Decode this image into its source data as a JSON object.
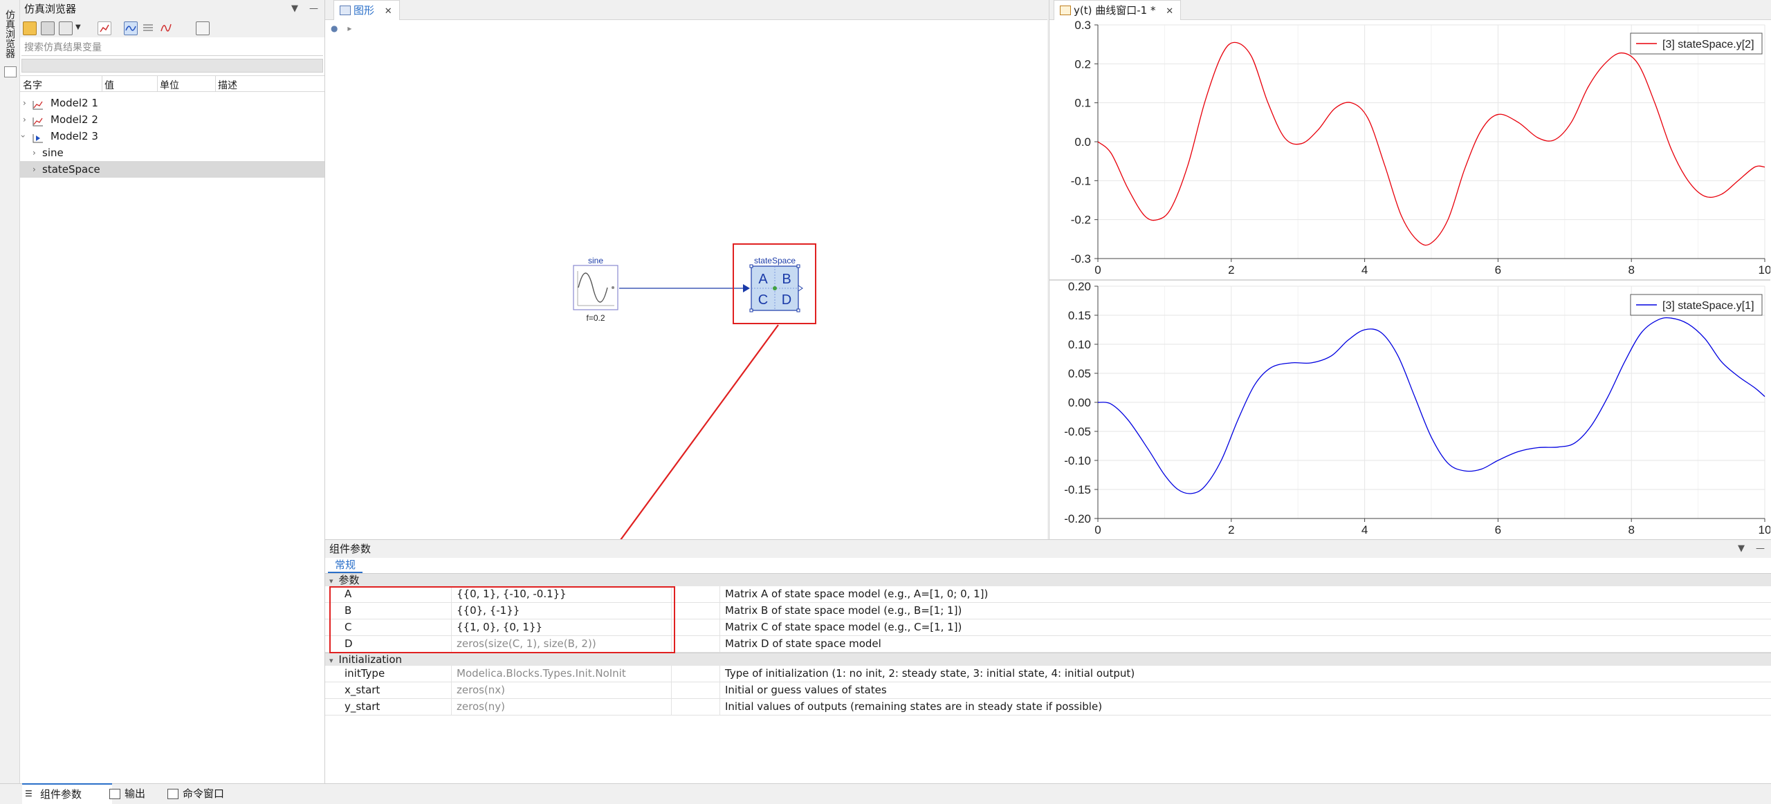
{
  "sim_browser": {
    "vertical_tab_label": "仿真浏览器",
    "title": "仿真浏览器",
    "search_placeholder": "搜索仿真结果变量",
    "columns": [
      "名字",
      "值",
      "单位",
      "描述"
    ],
    "tree": [
      {
        "label": "Model2 1",
        "icon": "plot-result-icon",
        "expanded": false,
        "level": 0
      },
      {
        "label": "Model2 2",
        "icon": "plot-result-icon",
        "expanded": false,
        "level": 0
      },
      {
        "label": "Model2 3",
        "icon": "run-result-icon",
        "expanded": true,
        "level": 0
      },
      {
        "label": "sine",
        "expanded": false,
        "level": 1
      },
      {
        "label": "stateSpace",
        "expanded": false,
        "level": 1,
        "selected": true
      }
    ]
  },
  "diagram": {
    "tab_label": "图形",
    "sine_label": "sine",
    "sine_param": "f=0.2",
    "ss_label": "stateSpace",
    "ss_letters": [
      "A",
      "B",
      "C",
      "D"
    ]
  },
  "plot_window": {
    "tab_label": "y(t) 曲线窗口-1 *"
  },
  "chart_data": [
    {
      "type": "line",
      "title": "",
      "xlabel": "",
      "ylabel": "",
      "xlim": [
        0,
        10
      ],
      "ylim": [
        -0.3,
        0.3
      ],
      "x_ticks": [
        "0",
        "2",
        "4",
        "6",
        "8",
        "10"
      ],
      "y_ticks": [
        "0.3",
        "0.2",
        "0.1",
        "0.0",
        "-0.1",
        "-0.2",
        "-0.3"
      ],
      "grid": true,
      "legend_position": "top-right",
      "series": [
        {
          "name": "[3] stateSpace.y[2]",
          "color": "#e8000b",
          "x": [
            0,
            0.2,
            0.45,
            0.7,
            0.9,
            1.1,
            1.35,
            1.6,
            1.85,
            2.05,
            2.3,
            2.55,
            2.8,
            3.05,
            3.3,
            3.55,
            3.8,
            4.05,
            4.3,
            4.55,
            4.8,
            5.0,
            5.25,
            5.5,
            5.75,
            6.0,
            6.3,
            6.6,
            6.85,
            7.1,
            7.35,
            7.6,
            7.85,
            8.1,
            8.35,
            8.6,
            8.85,
            9.1,
            9.35,
            9.6,
            9.85,
            10.0
          ],
          "y": [
            0,
            -0.03,
            -0.12,
            -0.19,
            -0.2,
            -0.17,
            -0.06,
            0.1,
            0.22,
            0.255,
            0.22,
            0.1,
            0.01,
            -0.005,
            0.03,
            0.085,
            0.1,
            0.06,
            -0.06,
            -0.19,
            -0.255,
            -0.26,
            -0.2,
            -0.07,
            0.03,
            0.07,
            0.05,
            0.01,
            0.005,
            0.05,
            0.14,
            0.2,
            0.228,
            0.2,
            0.1,
            -0.02,
            -0.1,
            -0.14,
            -0.135,
            -0.1,
            -0.065,
            -0.065
          ]
        }
      ]
    },
    {
      "type": "line",
      "title": "",
      "xlabel": "",
      "ylabel": "",
      "xlim": [
        0,
        10
      ],
      "ylim": [
        -0.2,
        0.2
      ],
      "x_ticks": [
        "0",
        "2",
        "4",
        "6",
        "8",
        "10"
      ],
      "y_ticks": [
        "0.20",
        "0.15",
        "0.10",
        "0.05",
        "0.00",
        "-0.05",
        "-0.10",
        "-0.15",
        "-0.20"
      ],
      "grid": true,
      "legend_position": "top-right",
      "series": [
        {
          "name": "[3] stateSpace.y[1]",
          "color": "#0000e0",
          "x": [
            0,
            0.2,
            0.45,
            0.75,
            1.0,
            1.2,
            1.4,
            1.6,
            1.85,
            2.1,
            2.35,
            2.6,
            2.9,
            3.2,
            3.5,
            3.75,
            4.0,
            4.25,
            4.5,
            4.75,
            5.0,
            5.25,
            5.5,
            5.75,
            6.0,
            6.3,
            6.6,
            6.9,
            7.15,
            7.4,
            7.65,
            7.9,
            8.15,
            8.4,
            8.6,
            8.85,
            9.1,
            9.35,
            9.6,
            9.85,
            10.0
          ],
          "y": [
            0,
            -0.003,
            -0.03,
            -0.08,
            -0.125,
            -0.15,
            -0.157,
            -0.145,
            -0.1,
            -0.03,
            0.03,
            0.06,
            0.068,
            0.068,
            0.08,
            0.107,
            0.125,
            0.12,
            0.08,
            0.01,
            -0.06,
            -0.105,
            -0.118,
            -0.115,
            -0.1,
            -0.085,
            -0.078,
            -0.077,
            -0.07,
            -0.04,
            0.01,
            0.07,
            0.12,
            0.142,
            0.145,
            0.135,
            0.11,
            0.07,
            0.045,
            0.025,
            0.01
          ]
        }
      ]
    }
  ],
  "params_panel": {
    "title": "组件参数",
    "tab": "常规",
    "groups": [
      {
        "label": "参数",
        "rows": [
          {
            "name": "A",
            "value": "{{0, 1}, {-10, -0.1}}",
            "default": false,
            "desc": "Matrix A of state space model (e.g., A=[1, 0; 0, 1])"
          },
          {
            "name": "B",
            "value": "{{0}, {-1}}",
            "default": false,
            "desc": "Matrix B of state space model (e.g., B=[1; 1])"
          },
          {
            "name": "C",
            "value": "{{1, 0}, {0, 1}}",
            "default": false,
            "desc": "Matrix C of state space model (e.g., C=[1, 1])"
          },
          {
            "name": "D",
            "value": "zeros(size(C, 1), size(B, 2))",
            "default": true,
            "desc": "Matrix D of state space model"
          }
        ]
      },
      {
        "label": "Initialization",
        "rows": [
          {
            "name": "initType",
            "value": "Modelica.Blocks.Types.Init.NoInit",
            "default": true,
            "desc": "Type of initialization (1: no init, 2: steady state, 3: initial state, 4: initial output)"
          },
          {
            "name": "x_start",
            "value": "zeros(nx)",
            "default": true,
            "desc": "Initial or guess values of states"
          },
          {
            "name": "y_start",
            "value": "zeros(ny)",
            "default": true,
            "desc": "Initial values of outputs (remaining states are in steady state if possible)"
          }
        ]
      }
    ]
  },
  "statusbar": {
    "buttons": [
      "组件参数",
      "输出",
      "命令窗口"
    ]
  },
  "colors": {
    "highlight_red": "#e02020",
    "accent_blue": "#2a6fc9",
    "block_blue": "#1a3aa8"
  }
}
